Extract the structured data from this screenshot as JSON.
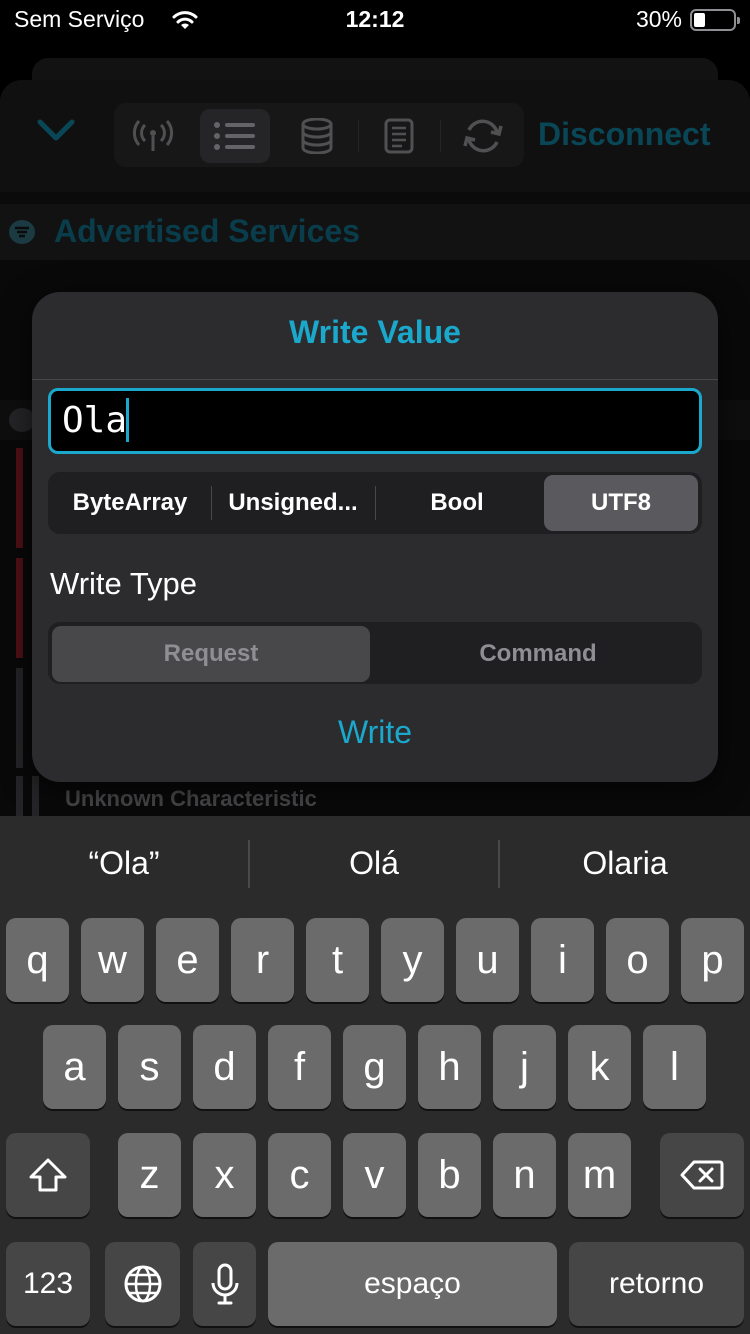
{
  "status": {
    "carrier": "Sem Serviço",
    "time": "12:12",
    "battery_pct": "30%",
    "battery_level": 0.3
  },
  "toolbar": {
    "collapse_icon": "chevron-down-icon",
    "tabs": [
      {
        "icon": "antenna-icon",
        "active": false
      },
      {
        "icon": "list-icon",
        "active": true
      },
      {
        "icon": "database-icon",
        "active": false
      },
      {
        "icon": "document-icon",
        "active": false
      },
      {
        "icon": "refresh-icon",
        "active": false
      }
    ],
    "disconnect_label": "Disconnect",
    "accent": "#0e6d86"
  },
  "background": {
    "section_title": "Advertised Services",
    "characteristic_label": "Unknown Characteristic"
  },
  "dialog": {
    "title": "Write Value",
    "input_value": "Ola",
    "format_options": [
      "ByteArray",
      "Unsigned...",
      "Bool",
      "UTF8"
    ],
    "format_selected": "UTF8",
    "write_type_label": "Write Type",
    "write_type_options": [
      "Request",
      "Command"
    ],
    "write_type_selected": "Request",
    "write_label": "Write",
    "accent": "#1aa8cc"
  },
  "keyboard": {
    "suggestions": [
      "“Ola”",
      "Olá",
      "Olaria"
    ],
    "row1": [
      "q",
      "w",
      "e",
      "r",
      "t",
      "y",
      "u",
      "i",
      "o",
      "p"
    ],
    "row2": [
      "a",
      "s",
      "d",
      "f",
      "g",
      "h",
      "j",
      "k",
      "l"
    ],
    "row3": [
      "z",
      "x",
      "c",
      "v",
      "b",
      "n",
      "m"
    ],
    "numbers_label": "123",
    "space_label": "espaço",
    "return_label": "retorno"
  }
}
